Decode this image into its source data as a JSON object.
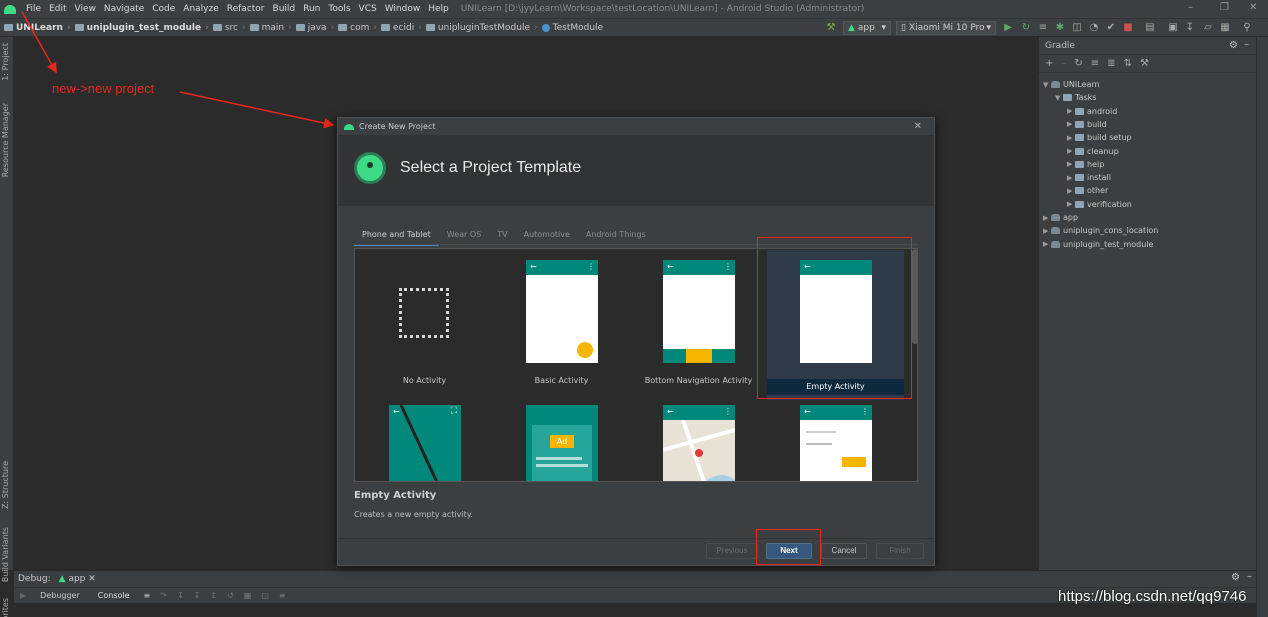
{
  "menubar": {
    "items": [
      "File",
      "Edit",
      "View",
      "Navigate",
      "Code",
      "Analyze",
      "Refactor",
      "Build",
      "Run",
      "Tools",
      "VCS",
      "Window",
      "Help"
    ],
    "window_title": "UNILearn [D:\\jyyLearn\\Workspace\\testLocation\\UNILearn] - Android Studio (Administrator)"
  },
  "breadcrumbs": [
    "UNILearn",
    "uniplugin_test_module",
    "src",
    "main",
    "java",
    "com",
    "ecidi",
    "unipluginTestModule",
    "TestModule"
  ],
  "toolbar": {
    "run_config": "app",
    "device": "Xiaomi Mi 10 Pro"
  },
  "left_tabs": [
    "1: Project",
    "Resource Manager",
    "Z: Structure",
    "Build Variants",
    "Favorites"
  ],
  "gradle": {
    "title": "Gradle",
    "tree": [
      {
        "label": "UNILearn",
        "level": 0,
        "expanded": true,
        "icon": "gradle-icon"
      },
      {
        "label": "Tasks",
        "level": 1,
        "expanded": true,
        "icon": "folder-icon"
      },
      {
        "label": "android",
        "level": 2,
        "expanded": false,
        "icon": "folder-icon"
      },
      {
        "label": "build",
        "level": 2,
        "expanded": false,
        "icon": "folder-icon"
      },
      {
        "label": "build setup",
        "level": 2,
        "expanded": false,
        "icon": "folder-icon"
      },
      {
        "label": "cleanup",
        "level": 2,
        "expanded": false,
        "icon": "folder-icon"
      },
      {
        "label": "help",
        "level": 2,
        "expanded": false,
        "icon": "folder-icon"
      },
      {
        "label": "install",
        "level": 2,
        "expanded": false,
        "icon": "folder-icon"
      },
      {
        "label": "other",
        "level": 2,
        "expanded": false,
        "icon": "folder-icon"
      },
      {
        "label": "verification",
        "level": 2,
        "expanded": false,
        "icon": "folder-icon"
      },
      {
        "label": "app",
        "level": 0,
        "expanded": false,
        "icon": "gradle-icon"
      },
      {
        "label": "uniplugin_cons_location",
        "level": 0,
        "expanded": false,
        "icon": "gradle-icon"
      },
      {
        "label": "uniplugin_test_module",
        "level": 0,
        "expanded": false,
        "icon": "gradle-icon"
      }
    ]
  },
  "debug": {
    "label": "Debug:",
    "config": "app",
    "tabs": [
      "Debugger",
      "Console"
    ]
  },
  "annotation": "new->new project",
  "dialog": {
    "title": "Create New Project",
    "heading": "Select a Project Template",
    "tabs": [
      "Phone and Tablet",
      "Wear OS",
      "TV",
      "Automotive",
      "Android Things"
    ],
    "active_tab": "Phone and Tablet",
    "templates": [
      "No Activity",
      "Basic Activity",
      "Bottom Navigation Activity",
      "Empty Activity"
    ],
    "selected_template": "Empty Activity",
    "ad_label": "Ad",
    "description_title": "Empty Activity",
    "description_text": "Creates a new empty activity.",
    "buttons": {
      "previous": "Previous",
      "next": "Next",
      "cancel": "Cancel",
      "finish": "Finish"
    }
  },
  "watermark": "https://blog.csdn.net/qq9746",
  "colors": {
    "accent_teal": "#00897b",
    "highlight_red": "#e8261a",
    "selection_blue": "#0d293e",
    "primary_button": "#365880"
  }
}
